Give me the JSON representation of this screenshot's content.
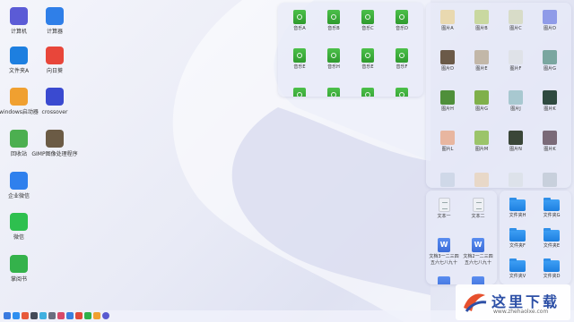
{
  "desktop_icons": [
    {
      "label": "计算机",
      "icon": "computer-icon",
      "color": "#5b5bd6"
    },
    {
      "label": "计算器",
      "icon": "calculator-icon",
      "color": "#2f7fe8"
    },
    {
      "label": "文件夹A",
      "icon": "folder-icon",
      "color": "#1d7fe0"
    },
    {
      "label": "向日葵",
      "icon": "sunflower-remote-icon",
      "color": "#e8463a"
    },
    {
      "label": "windows启动器",
      "icon": "windows-launcher-icon",
      "color": "#f0a030"
    },
    {
      "label": "crossover",
      "icon": "crossover-icon",
      "color": "#3a4ad0"
    },
    {
      "label": "回收站",
      "icon": "trash-icon",
      "color": "#4caf50"
    },
    {
      "label": "GIMP图像处理程序",
      "icon": "gimp-icon",
      "color": "#6b5b45"
    },
    {
      "label": "企业微信",
      "icon": "wecom-icon",
      "color": "#2f80ed"
    },
    {
      "label": "微信",
      "icon": "wechat-icon",
      "color": "#2ec04f"
    },
    {
      "label": "掌阅书",
      "icon": "ebook-icon",
      "color": "#34b24b"
    }
  ],
  "music_panel": {
    "items": [
      "音乐A",
      "音乐B",
      "音乐C",
      "音乐D",
      "音乐E",
      "音乐H",
      "音乐E",
      "音乐F"
    ]
  },
  "photo_panel": {
    "items": [
      {
        "label": "图片A",
        "color": "#e9d9b0"
      },
      {
        "label": "图片B",
        "color": "#c9d8a0"
      },
      {
        "label": "图片C",
        "color": "#d8dcc8"
      },
      {
        "label": "图片D",
        "color": "#8f9be8"
      },
      {
        "label": "图片D",
        "color": "#6b5a48"
      },
      {
        "label": "图片E",
        "color": "#c2b7a8"
      },
      {
        "label": "图片F",
        "color": "#dfe2e8"
      },
      {
        "label": "图片G",
        "color": "#7aa6a0"
      },
      {
        "label": "图片H",
        "color": "#4f8f3a"
      },
      {
        "label": "图片G",
        "color": "#7fb04a"
      },
      {
        "label": "图片J",
        "color": "#a8c8d0"
      },
      {
        "label": "图片K",
        "color": "#2f4a40"
      },
      {
        "label": "图片L",
        "color": "#e8b6a0"
      },
      {
        "label": "图片M",
        "color": "#9bc46a"
      },
      {
        "label": "图片N",
        "color": "#3a4638"
      },
      {
        "label": "图片K",
        "color": "#7a6a78"
      }
    ]
  },
  "docs_panel": {
    "items": [
      {
        "label": "文本一",
        "type": "text"
      },
      {
        "label": "文本二",
        "type": "text"
      },
      {
        "label": "文档3一二三四五六七八九十",
        "type": "word"
      },
      {
        "label": "文档2一二三四五六七八九十",
        "type": "word"
      }
    ]
  },
  "folders_panel": {
    "items": [
      "文件夹H",
      "文件夹G",
      "文件夹F",
      "文件夹E",
      "文件夹V",
      "文件夹D"
    ]
  },
  "taskbar": {
    "icons": [
      "launcher-icon",
      "file-manager-icon",
      "browser-icon",
      "terminal-icon",
      "store-icon",
      "settings-icon",
      "mail-icon",
      "music-player-icon",
      "video-icon",
      "chat-icon",
      "chrome-icon",
      "clock-icon"
    ]
  },
  "watermark": {
    "title": "这里下载",
    "url": "www.zhehaolxe.com"
  }
}
